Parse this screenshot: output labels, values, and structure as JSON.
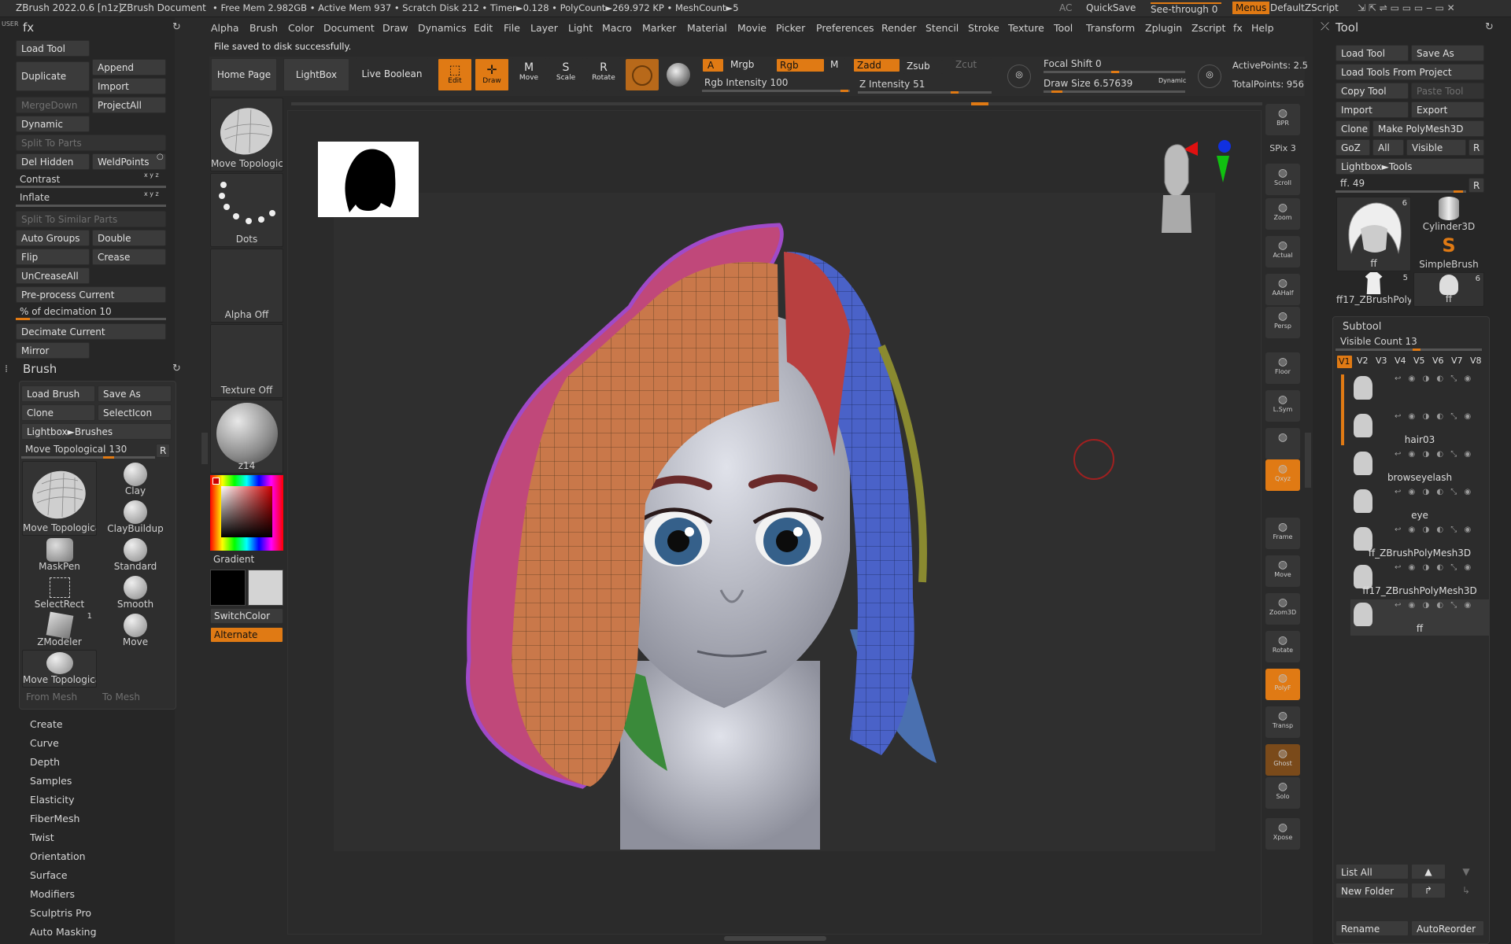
{
  "titlebar": {
    "app": "ZBrush 2022.0.6 [n1z]",
    "document": "ZBrush Document",
    "stats": "• Free Mem 2.982GB • Active Mem 937 • Scratch Disk 212 •  Timer►0.128 • PolyCount►269.972 KP  • MeshCount►5",
    "ac": "AC",
    "quicksave": "QuickSave",
    "seethrough": "See-through",
    "seethrough_value": "0",
    "menus": "Menus",
    "zscript": "DefaultZScript"
  },
  "menubar": [
    "Alpha",
    "Brush",
    "Color",
    "Document",
    "Draw",
    "Dynamics",
    "Edit",
    "File",
    "Layer",
    "Light",
    "Macro",
    "Marker",
    "Material",
    "Movie",
    "Picker",
    "Preferences",
    "Render",
    "Stencil",
    "Stroke",
    "Texture",
    "Tool",
    "Transform",
    "Zplugin",
    "Zscript",
    "fx",
    "Help"
  ],
  "notification": "File saved to disk successfully.",
  "left": {
    "fx_title": "fx",
    "load_tool": "Load Tool",
    "duplicate": "Duplicate",
    "append": "Append",
    "import": "Import",
    "mergedown": "MergeDown",
    "projectall": "ProjectAll",
    "dynamic": "Dynamic",
    "split_to_parts": "Split To Parts",
    "del_hidden": "Del Hidden",
    "weldpoints": "WeldPoints",
    "contrast": "Contrast",
    "inflate": "Inflate",
    "xyz": "x y z",
    "split_similar": "Split To Similar Parts",
    "auto_groups": "Auto Groups",
    "double": "Double",
    "flip": "Flip",
    "crease": "Crease",
    "uncreaseall": "UnCreaseAll",
    "preprocess": "Pre-process Current",
    "decimation_label": "% of decimation",
    "decimation_value": "10",
    "decimate_current": "Decimate Current",
    "mirror": "Mirror",
    "brush_title": "Brush",
    "load_brush": "Load Brush",
    "save_as": "Save As",
    "clone": "Clone",
    "selecticon": "SelectIcon",
    "lightbox_brushes": "Lightbox►Brushes",
    "move_topo_label": "Move Topological",
    "move_topo_value": "130",
    "r": "R",
    "brushes": [
      {
        "name": "Move Topologica"
      },
      {
        "name": "Clay"
      },
      {
        "name": "ClayBuildup"
      },
      {
        "name": "MaskPen"
      },
      {
        "name": "Standard"
      },
      {
        "name": "SelectRect"
      },
      {
        "name": "Smooth"
      },
      {
        "name": "ZModeler",
        "badge": "1"
      },
      {
        "name": "Move"
      },
      {
        "name": "Move Topologica"
      }
    ],
    "from_mesh": "From Mesh",
    "to_mesh": "To Mesh",
    "sub_menus": [
      "Create",
      "Curve",
      "Depth",
      "Samples",
      "Elasticity",
      "FiberMesh",
      "Twist",
      "Orientation",
      "Surface",
      "Modifiers",
      "Sculptris Pro",
      "Auto Masking"
    ]
  },
  "shelf": {
    "home_page": "Home Page",
    "lightbox": "LightBox",
    "live_boolean": "Live Boolean",
    "edit": "Edit",
    "draw": "Draw",
    "move": "Move",
    "scale": "Scale",
    "rotate": "Rotate",
    "a": "A",
    "mrgb": "Mrgb",
    "rgb": "Rgb",
    "m": "M",
    "zadd": "Zadd",
    "zsub": "Zsub",
    "zcut": "Zcut",
    "rgb_intensity_label": "Rgb Intensity",
    "rgb_intensity_value": "100",
    "z_intensity_label": "Z Intensity",
    "z_intensity_value": "51",
    "focal_shift_label": "Focal Shift",
    "focal_shift_value": "0",
    "draw_size_label": "Draw Size",
    "draw_size_value": "6.57639",
    "dynamic": "Dynamic",
    "active_points": "ActivePoints: 2.5",
    "total_points": "TotalPoints: 956"
  },
  "palette": {
    "move_topo": "Move Topologica",
    "dots": "Dots",
    "alpha_off": "Alpha Off",
    "texture_off": "Texture Off",
    "material": "z14",
    "gradient": "Gradient",
    "switchcolor": "SwitchColor",
    "alternate": "Alternate"
  },
  "rightbar": [
    {
      "icon": "bpr-icon",
      "label": "BPR"
    },
    {
      "icon": "spix-icon",
      "label": "SPix 3"
    },
    {
      "icon": "scroll-icon",
      "label": "Scroll"
    },
    {
      "icon": "zoom-icon",
      "label": "Zoom"
    },
    {
      "icon": "actual-icon",
      "label": "Actual"
    },
    {
      "icon": "aahalf-icon",
      "label": "AAHalf"
    },
    {
      "icon": "persp-icon",
      "label": "Persp"
    },
    {
      "icon": "floor-icon",
      "label": "Floor"
    },
    {
      "icon": "lsym-icon",
      "label": "L.Sym"
    },
    {
      "icon": "lock-icon",
      "label": ""
    },
    {
      "icon": "xyz-icon",
      "label": "Qxyz"
    },
    {
      "icon": "frame-icon",
      "label": "Frame"
    },
    {
      "icon": "move-icon",
      "label": "Move"
    },
    {
      "icon": "zoom3d-icon",
      "label": "Zoom3D"
    },
    {
      "icon": "rotate-icon",
      "label": "Rotate"
    },
    {
      "icon": "polyf-icon",
      "label": "PolyF"
    },
    {
      "icon": "transp-icon",
      "label": "Transp"
    },
    {
      "icon": "ghost-icon",
      "label": "Ghost"
    },
    {
      "icon": "solo-icon",
      "label": "Solo"
    },
    {
      "icon": "xpose-icon",
      "label": "Xpose"
    }
  ],
  "tool": {
    "title": "Tool",
    "load_tool": "Load Tool",
    "save_as": "Save As",
    "load_from_project": "Load Tools From Project",
    "copy_tool": "Copy Tool",
    "paste_tool": "Paste Tool",
    "import": "Import",
    "export": "Export",
    "clone": "Clone",
    "make_polymesh": "Make PolyMesh3D",
    "goz": "GoZ",
    "all": "All",
    "visible": "Visible",
    "r": "R",
    "lightbox_tools": "Lightbox►Tools",
    "ff_label": "ff.",
    "ff_value": "49",
    "thumbs": [
      {
        "name": "ff",
        "badge": "6"
      },
      {
        "name": "Cylinder3D"
      },
      {
        "name": "SimpleBrush"
      },
      {
        "name": "ff17_ZBrushPolyM",
        "badge": "5"
      },
      {
        "name": "ff",
        "badge": "6"
      }
    ],
    "subtool_title": "Subtool",
    "visible_count_label": "Visible Count",
    "visible_count_value": "13",
    "versions": [
      "V1",
      "V2",
      "V3",
      "V4",
      "V5",
      "V6",
      "V7",
      "V8"
    ],
    "subtools": [
      "",
      "hair03",
      "browseyelash",
      "eye",
      "ff_ZBrushPolyMesh3D",
      "ff17_ZBrushPolyMesh3D",
      "ff"
    ],
    "list_all": "List All",
    "new_folder": "New Folder",
    "rename": "Rename",
    "autoreorder": "AutoReorder"
  },
  "colors": {
    "accent": "#e07a14",
    "panel": "#262626",
    "canvas": "#2d2d2d",
    "hair_orange": "#c9784a",
    "hair_pink": "#c0487a",
    "hair_purple": "#a04ac8",
    "hair_blue": "#4a62c8",
    "hair_red": "#b84040",
    "hair_green": "#3a8a3a"
  }
}
